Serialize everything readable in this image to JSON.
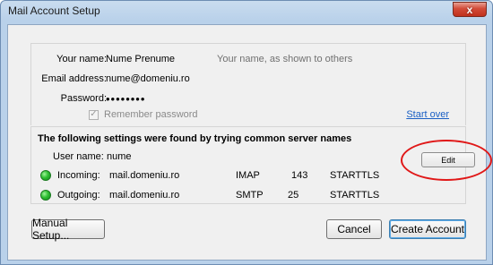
{
  "window": {
    "title": "Mail Account Setup",
    "close_glyph": "x"
  },
  "form": {
    "name_label": "Your name:",
    "name_value": "Nume Prenume",
    "name_hint": "Your name, as shown to others",
    "email_label": "Email address:",
    "email_value": "nume@domeniu.ro",
    "password_label": "Password:",
    "password_value": "••••••••",
    "remember_label": "Remember password",
    "remember_checked": true,
    "start_over": "Start over"
  },
  "found": {
    "title": "The following settings were found by trying common server names",
    "username_label": "User name:",
    "username_value": "nume",
    "edit_button": "Edit",
    "incoming": {
      "label": "Incoming:",
      "server": "mail.domeniu.ro",
      "protocol": "IMAP",
      "port": "143",
      "security": "STARTTLS",
      "status_color": "#2fbf33"
    },
    "outgoing": {
      "label": "Outgoing:",
      "server": "mail.domeniu.ro",
      "protocol": "SMTP",
      "port": "25",
      "security": "STARTTLS",
      "status_color": "#2fbf33"
    }
  },
  "buttons": {
    "manual_setup": "Manual Setup...",
    "cancel": "Cancel",
    "create_account": "Create Account"
  },
  "annotation": {
    "highlight_color": "#e01818"
  }
}
